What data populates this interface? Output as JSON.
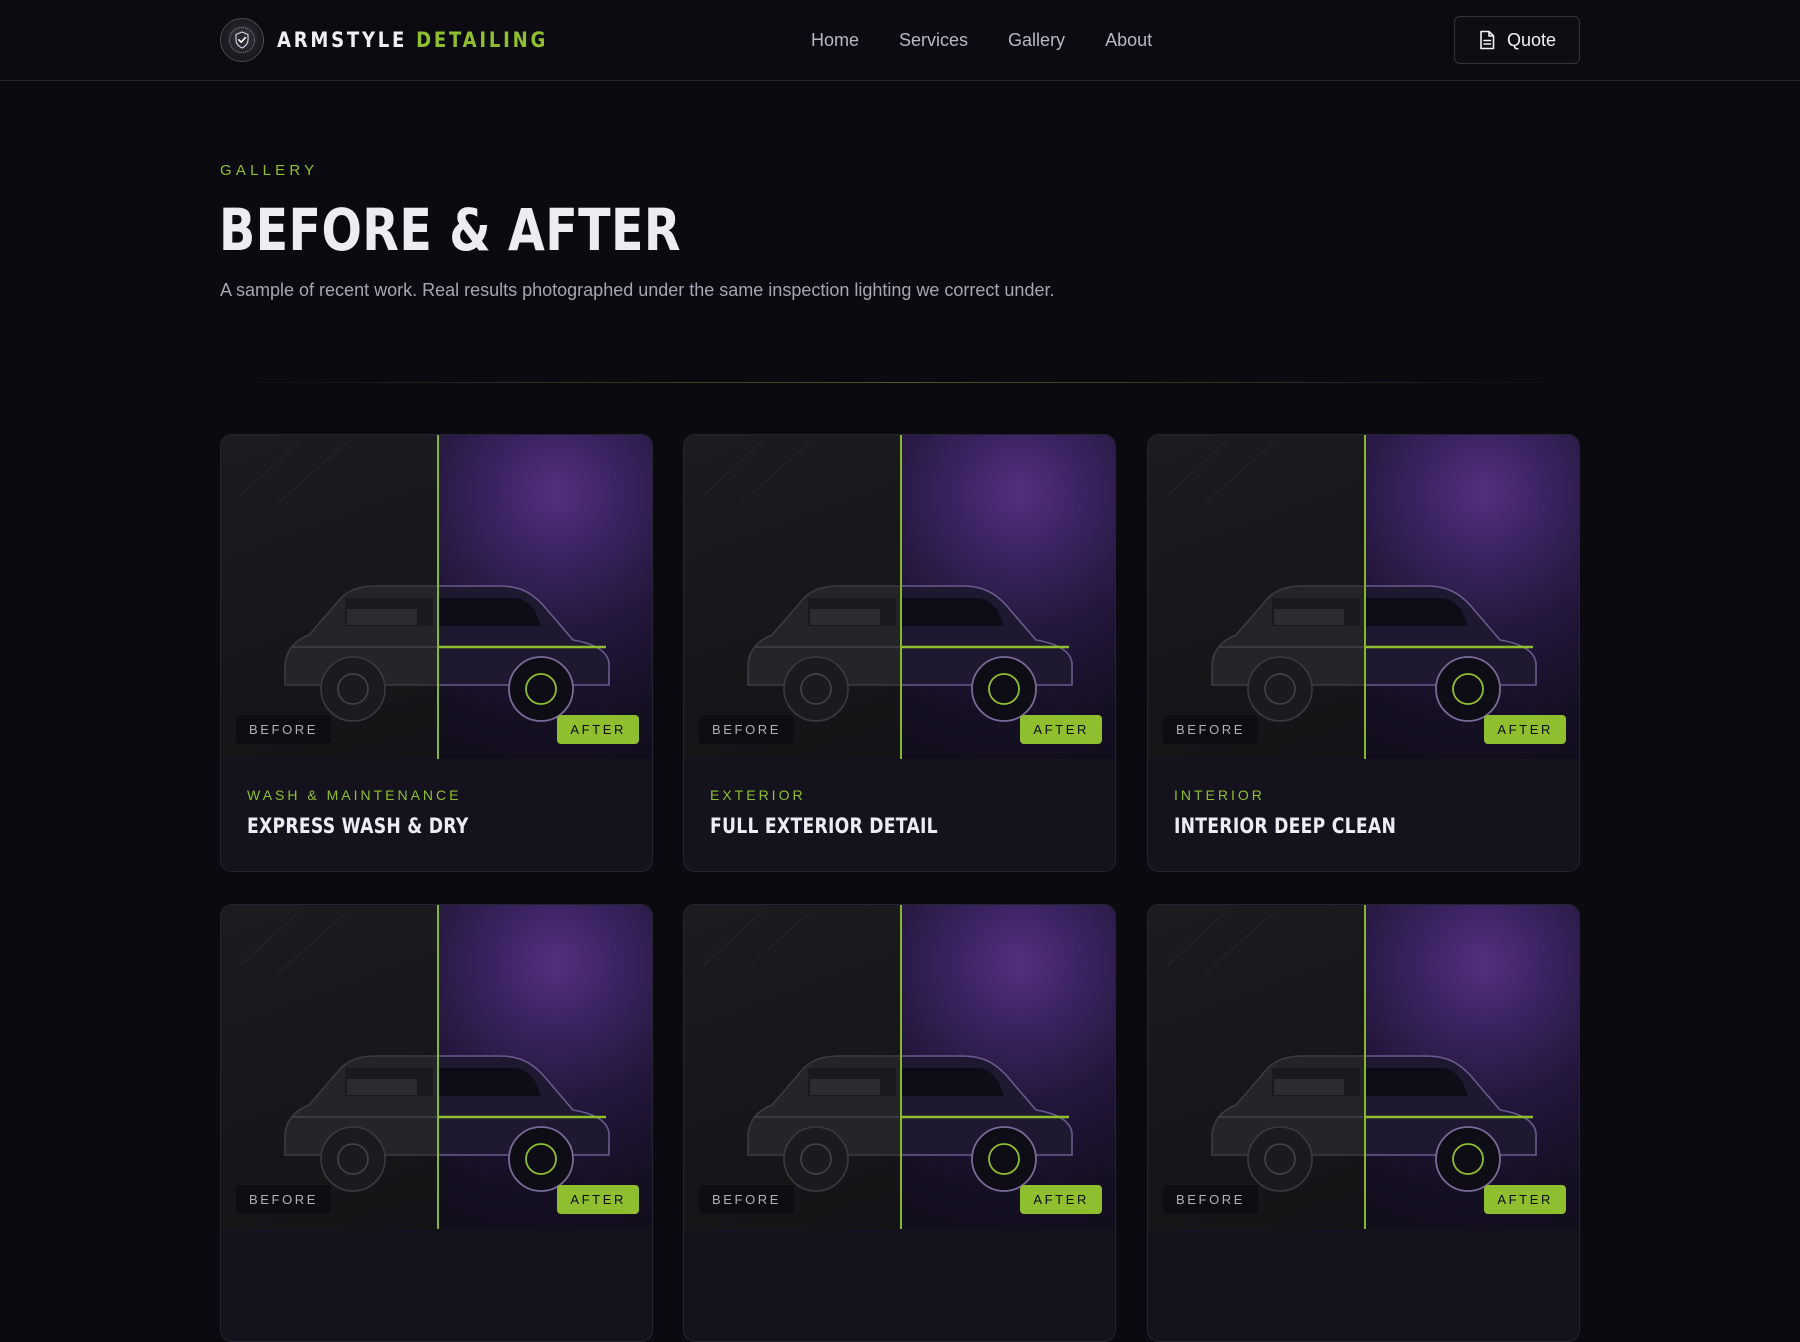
{
  "brand": {
    "name_part1": "ARMSTYLE",
    "name_part2": "DETAILING",
    "logo_icon": "shield-check-logo"
  },
  "nav": {
    "items": [
      "Home",
      "Services",
      "Gallery",
      "About"
    ]
  },
  "quote_button": {
    "label": "Quote",
    "icon": "document-icon"
  },
  "hero": {
    "eyebrow": "GALLERY",
    "title": "BEFORE & AFTER",
    "subtitle": "A sample of recent work. Real results photographed under the same inspection lighting we correct under."
  },
  "colors": {
    "accent": "#8fbf2f",
    "background": "#0a0a10",
    "after_glow": "#54307e"
  },
  "gallery": {
    "before_label": "BEFORE",
    "after_label": "AFTER",
    "cards": [
      {
        "category": "WASH & MAINTENANCE",
        "title": "EXPRESS WASH & DRY"
      },
      {
        "category": "EXTERIOR",
        "title": "FULL EXTERIOR DETAIL"
      },
      {
        "category": "INTERIOR",
        "title": "INTERIOR DEEP CLEAN"
      },
      {
        "category": "",
        "title": ""
      },
      {
        "category": "",
        "title": ""
      },
      {
        "category": "",
        "title": ""
      }
    ]
  }
}
